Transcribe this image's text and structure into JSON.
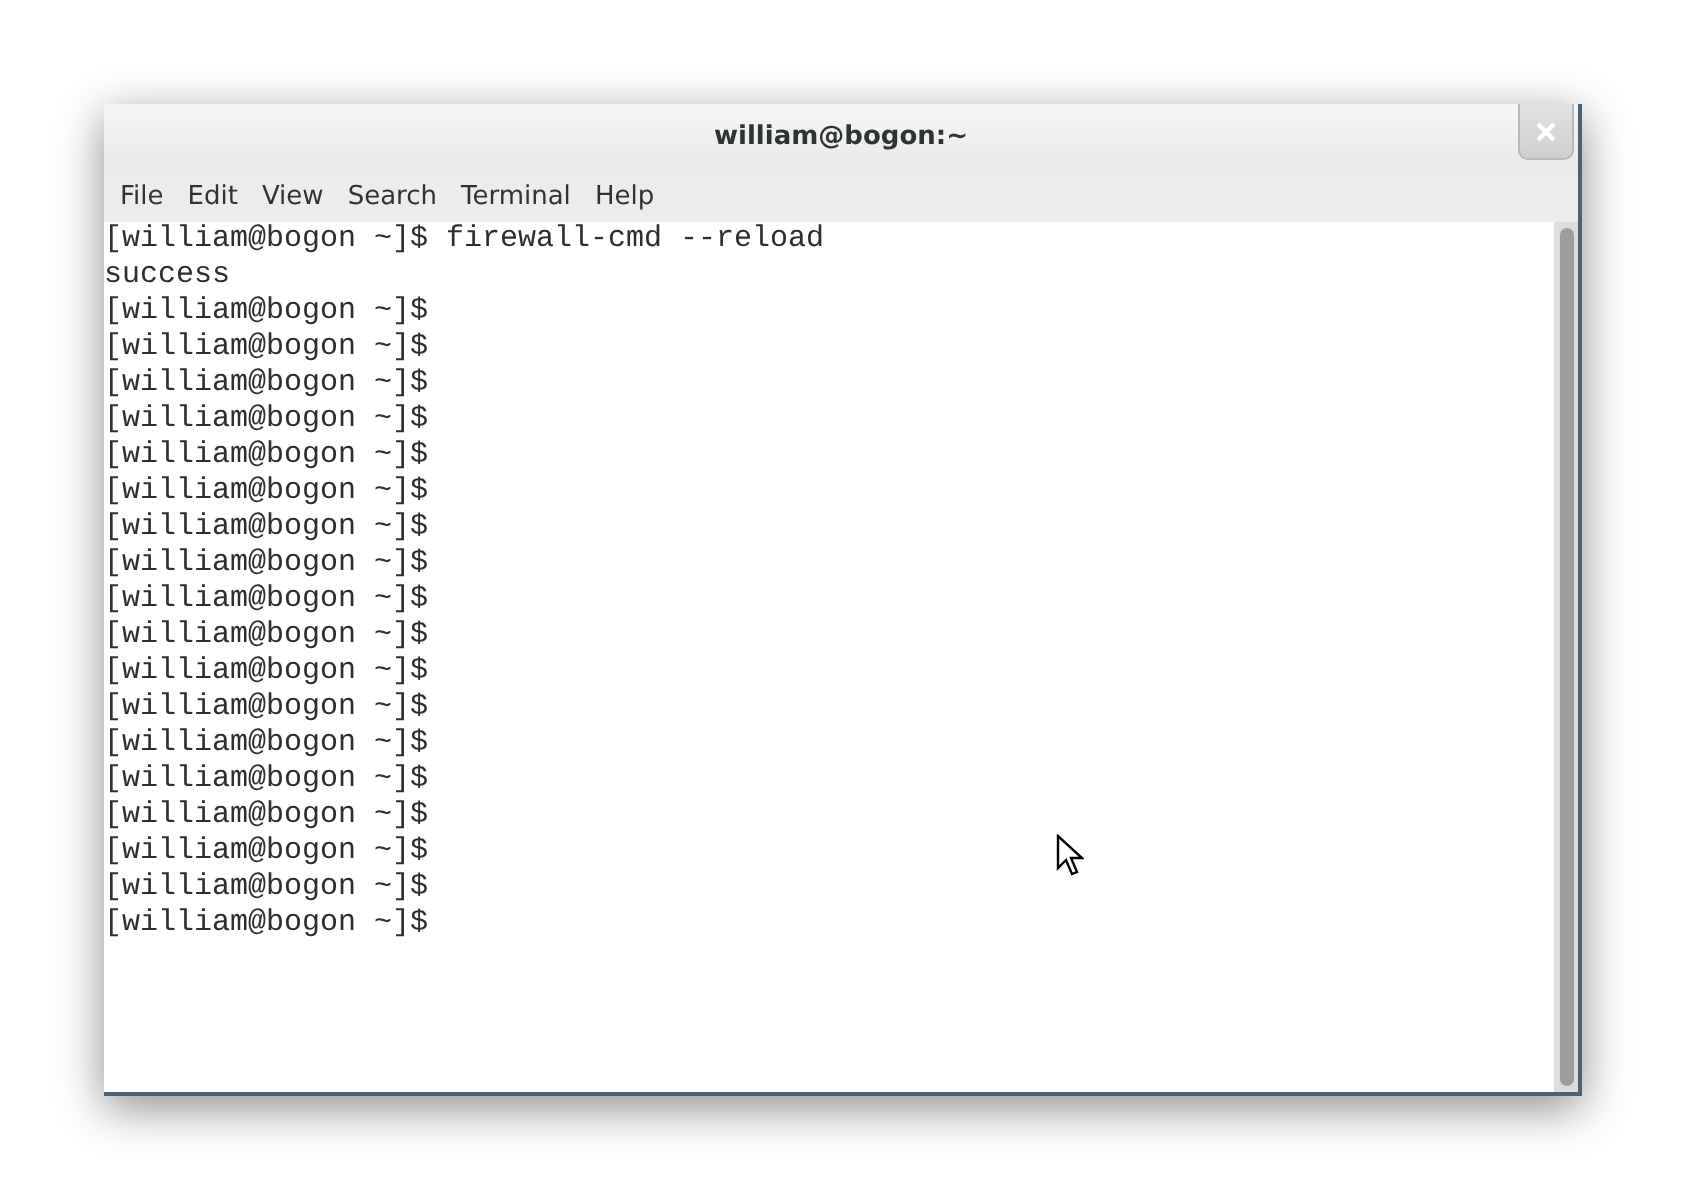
{
  "window": {
    "title": "william@bogon:~"
  },
  "menu": [
    "File",
    "Edit",
    "View",
    "Search",
    "Terminal",
    "Help"
  ],
  "terminal": {
    "lines": [
      "[william@bogon ~]$ firewall-cmd --reload",
      "success",
      "[william@bogon ~]$",
      "[william@bogon ~]$",
      "[william@bogon ~]$",
      "[william@bogon ~]$",
      "[william@bogon ~]$",
      "[william@bogon ~]$",
      "[william@bogon ~]$",
      "[william@bogon ~]$",
      "[william@bogon ~]$",
      "[william@bogon ~]$",
      "[william@bogon ~]$",
      "[william@bogon ~]$",
      "[william@bogon ~]$",
      "[william@bogon ~]$",
      "[william@bogon ~]$",
      "[william@bogon ~]$",
      "[william@bogon ~]$",
      "[william@bogon ~]$"
    ]
  }
}
